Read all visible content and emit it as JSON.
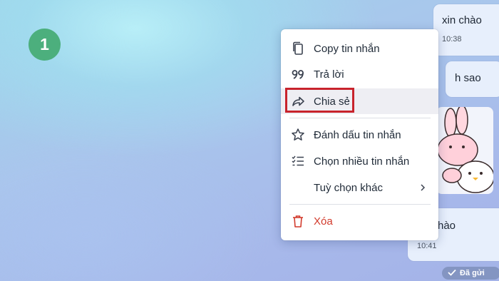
{
  "step_badge": "1",
  "messages": [
    {
      "text": "xin chào",
      "time": "10:38"
    },
    {
      "text": "h sao"
    },
    {
      "text": "hào",
      "time": "10:41"
    }
  ],
  "status": {
    "label": "Đã gửi"
  },
  "context_menu": {
    "items": [
      {
        "label": "Copy tin nhắn",
        "icon": "copy-icon"
      },
      {
        "label": "Trả lời",
        "icon": "quote-icon"
      },
      {
        "label": "Chia sẻ",
        "icon": "share-icon",
        "highlighted": true
      },
      {
        "label": "Đánh dấu tin nhắn",
        "icon": "star-icon"
      },
      {
        "label": "Chọn nhiều tin nhắn",
        "icon": "multi-select-icon"
      },
      {
        "label": "Tuỳ chọn khác",
        "icon": "chevron-right-icon"
      },
      {
        "label": "Xóa",
        "icon": "trash-icon",
        "danger": true
      }
    ]
  },
  "colors": {
    "badge": "#4caf7d",
    "danger": "#d23a2c",
    "highlight_box": "#c8232c"
  }
}
